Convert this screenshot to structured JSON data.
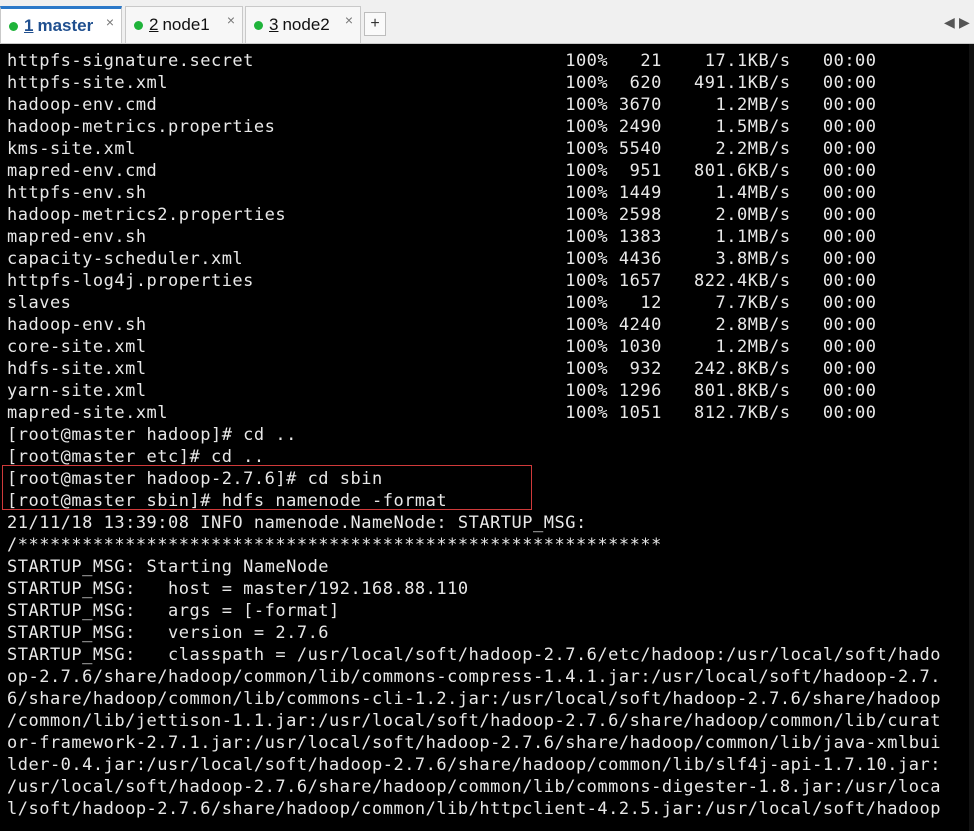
{
  "tabs": [
    {
      "num": "1",
      "label": "master",
      "close": "×"
    },
    {
      "num": "2",
      "label": "node1",
      "close": "×"
    },
    {
      "num": "3",
      "label": "node2",
      "close": "×"
    }
  ],
  "add_tab_label": "+",
  "nav": {
    "prev": "◀",
    "next": "▶"
  },
  "terminal_lines": [
    "httpfs-signature.secret                             100%   21    17.1KB/s   00:00",
    "httpfs-site.xml                                     100%  620   491.1KB/s   00:00",
    "hadoop-env.cmd                                      100% 3670     1.2MB/s   00:00",
    "hadoop-metrics.properties                           100% 2490     1.5MB/s   00:00",
    "kms-site.xml                                        100% 5540     2.2MB/s   00:00",
    "mapred-env.cmd                                      100%  951   801.6KB/s   00:00",
    "httpfs-env.sh                                       100% 1449     1.4MB/s   00:00",
    "hadoop-metrics2.properties                          100% 2598     2.0MB/s   00:00",
    "mapred-env.sh                                       100% 1383     1.1MB/s   00:00",
    "capacity-scheduler.xml                              100% 4436     3.8MB/s   00:00",
    "httpfs-log4j.properties                             100% 1657   822.4KB/s   00:00",
    "slaves                                              100%   12     7.7KB/s   00:00",
    "hadoop-env.sh                                       100% 4240     2.8MB/s   00:00",
    "core-site.xml                                       100% 1030     1.2MB/s   00:00",
    "hdfs-site.xml                                       100%  932   242.8KB/s   00:00",
    "yarn-site.xml                                       100% 1296   801.8KB/s   00:00",
    "mapred-site.xml                                     100% 1051   812.7KB/s   00:00",
    "[root@master hadoop]# cd ..",
    "[root@master etc]# cd ..",
    "[root@master hadoop-2.7.6]# cd sbin",
    "[root@master sbin]# hdfs namenode -format",
    "21/11/18 13:39:08 INFO namenode.NameNode: STARTUP_MSG:",
    "/************************************************************",
    "STARTUP_MSG: Starting NameNode",
    "STARTUP_MSG:   host = master/192.168.88.110",
    "STARTUP_MSG:   args = [-format]",
    "STARTUP_MSG:   version = 2.7.6",
    "STARTUP_MSG:   classpath = /usr/local/soft/hadoop-2.7.6/etc/hadoop:/usr/local/soft/hado",
    "op-2.7.6/share/hadoop/common/lib/commons-compress-1.4.1.jar:/usr/local/soft/hadoop-2.7.",
    "6/share/hadoop/common/lib/commons-cli-1.2.jar:/usr/local/soft/hadoop-2.7.6/share/hadoop",
    "/common/lib/jettison-1.1.jar:/usr/local/soft/hadoop-2.7.6/share/hadoop/common/lib/curat",
    "or-framework-2.7.1.jar:/usr/local/soft/hadoop-2.7.6/share/hadoop/common/lib/java-xmlbui",
    "lder-0.4.jar:/usr/local/soft/hadoop-2.7.6/share/hadoop/common/lib/slf4j-api-1.7.10.jar:",
    "/usr/local/soft/hadoop-2.7.6/share/hadoop/common/lib/commons-digester-1.8.jar:/usr/loca",
    "l/soft/hadoop-2.7.6/share/hadoop/common/lib/httpclient-4.2.5.jar:/usr/local/soft/hadoop"
  ],
  "colors": {
    "terminal_bg": "#000000",
    "terminal_fg": "#e8e8e8",
    "highlight_border": "#d03a3a",
    "tab_active_accent": "#2b78c8",
    "status_dot": "#1fb33a"
  }
}
